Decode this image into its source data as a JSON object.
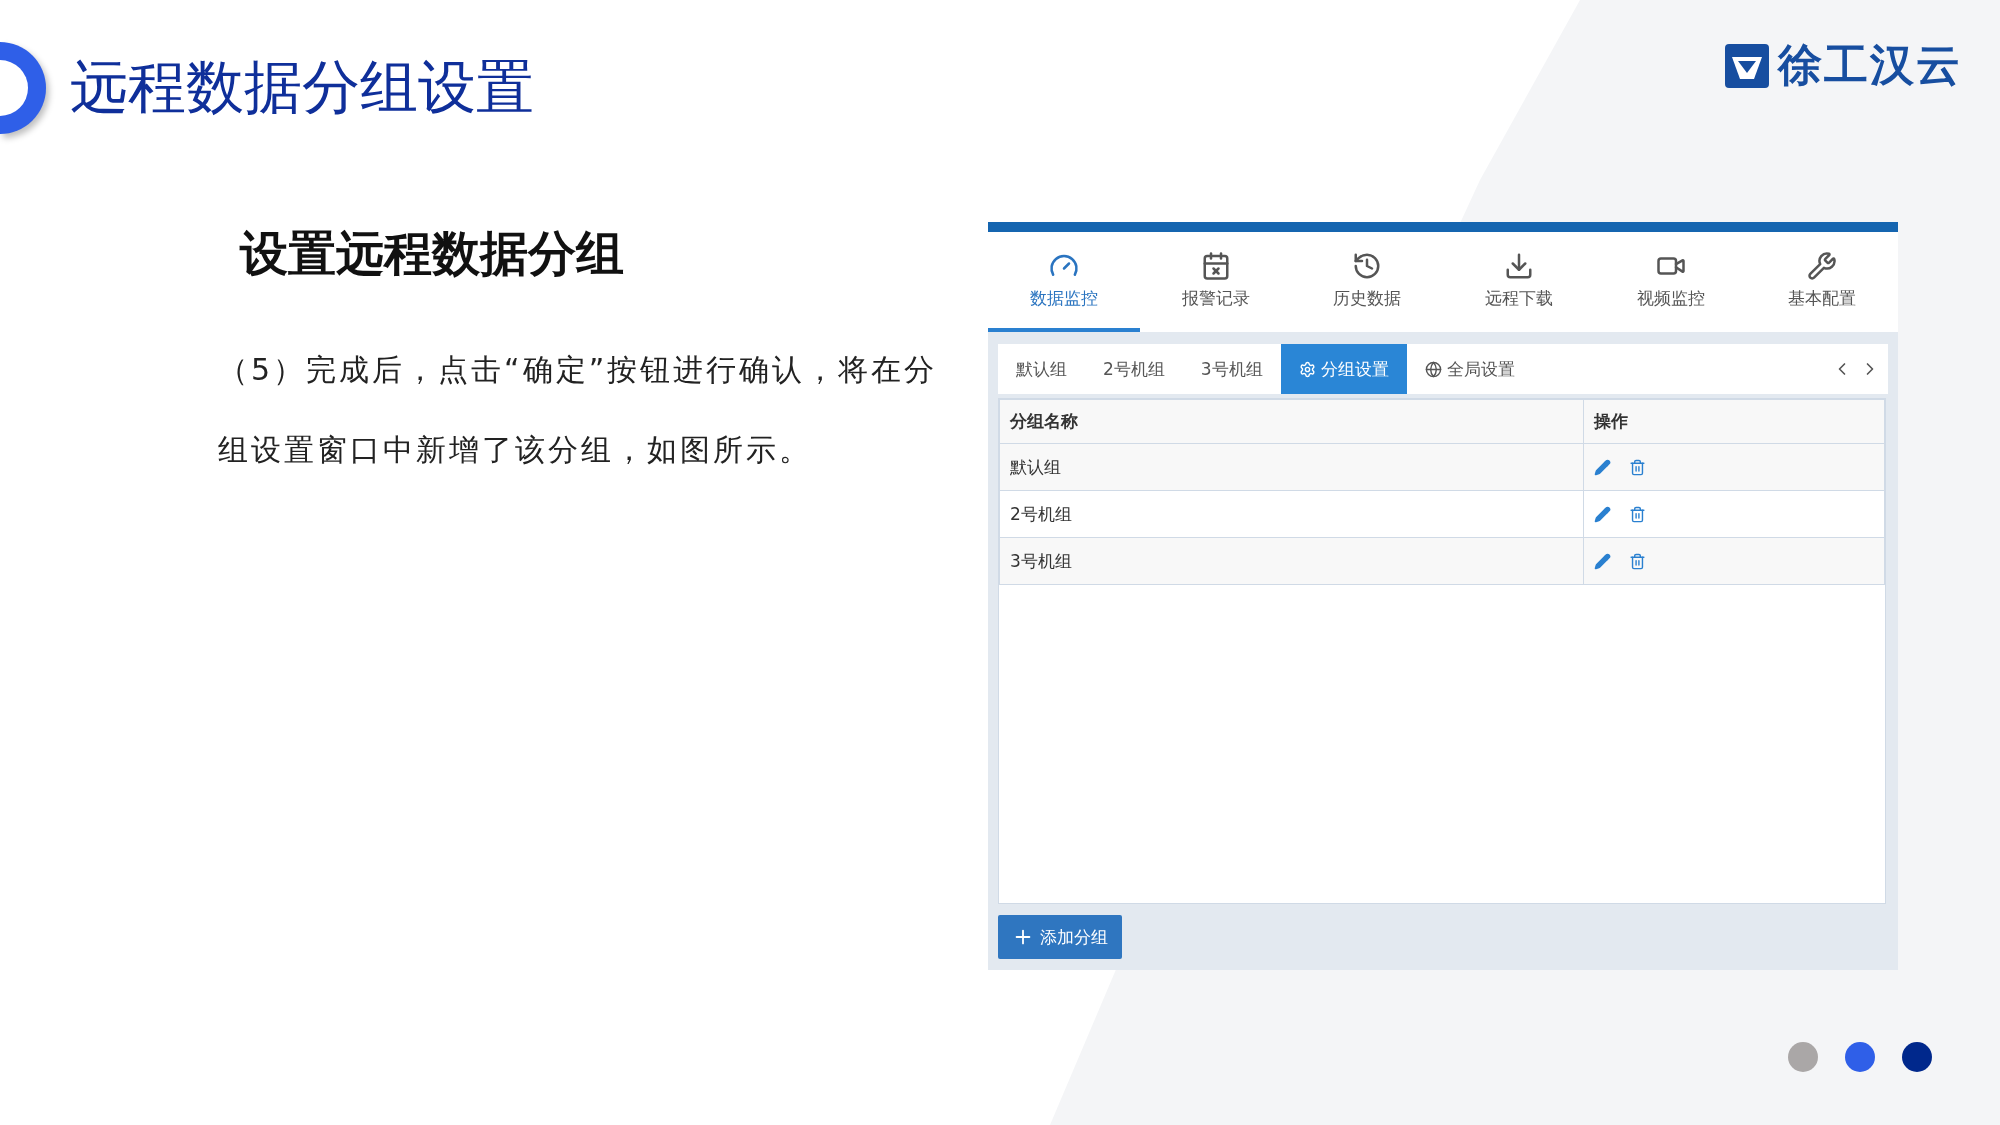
{
  "slide": {
    "title": "远程数据分组设置",
    "logo_text": "徐工汉云",
    "heading": "设置远程数据分组",
    "paragraph": "（5）完成后，点击“确定”按钮进行确认，将在分组设置窗口中新增了该分组，如图所示。"
  },
  "app": {
    "nav": [
      {
        "label": "数据监控",
        "selected": true
      },
      {
        "label": "报警记录",
        "selected": false
      },
      {
        "label": "历史数据",
        "selected": false
      },
      {
        "label": "远程下载",
        "selected": false
      },
      {
        "label": "视频监控",
        "selected": false
      },
      {
        "label": "基本配置",
        "selected": false
      }
    ],
    "subtabs": [
      {
        "label": "默认组",
        "selected": false
      },
      {
        "label": "2号机组",
        "selected": false
      },
      {
        "label": "3号机组",
        "selected": false
      },
      {
        "label": "分组设置",
        "selected": true
      },
      {
        "label": "全局设置",
        "selected": false
      }
    ],
    "table": {
      "columns": [
        "分组名称",
        "操作"
      ],
      "rows": [
        {
          "name": "默认组"
        },
        {
          "name": "2号机组"
        },
        {
          "name": "3号机组"
        }
      ]
    },
    "add_button": "添加分组"
  },
  "pager_dots": [
    {
      "color": "#aaa7a7"
    },
    {
      "color": "#2f5fe8"
    },
    {
      "color": "#00288c"
    }
  ]
}
